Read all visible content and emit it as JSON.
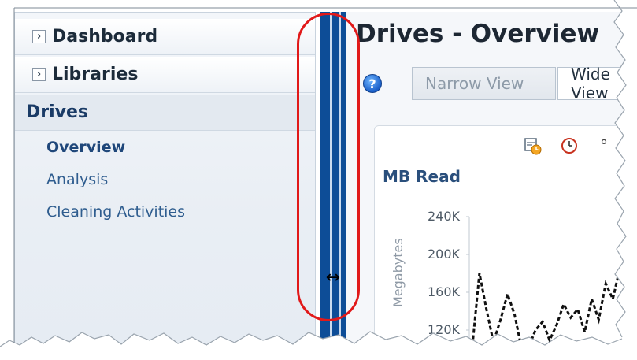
{
  "nav": {
    "dashboard": "Dashboard",
    "libraries": "Libraries",
    "drives": "Drives",
    "drive_items": [
      "Overview",
      "Analysis",
      "Cleaning Activities"
    ],
    "chevron": "chevron-right-icon"
  },
  "main": {
    "page_title": "Drives - Overview",
    "help_icon": "?",
    "narrow_view": "Narrow View",
    "wide_view": "Wide View"
  },
  "chart": {
    "toolbar_icons": [
      "calendar-clock-icon",
      "clock-icon",
      "more-icon"
    ],
    "title": "MB Read",
    "ylabel": "Megabytes"
  },
  "chart_data": {
    "type": "line",
    "title": "MB Read",
    "ylabel": "Megabytes",
    "yticks": [
      "240K",
      "200K",
      "160K",
      "120K"
    ],
    "ylim": [
      110000,
      240000
    ],
    "series": [
      {
        "style": "dashed",
        "color": "#111111",
        "values": [
          115000,
          185000,
          150000,
          118000,
          140000,
          165000,
          145000,
          112000,
          113000,
          130000,
          138000,
          120000,
          135000,
          155000,
          142000,
          150000,
          128000,
          160000,
          140000,
          175000,
          160000,
          190000,
          165000,
          135000
        ]
      }
    ]
  },
  "colors": {
    "splitter": "#0d4d97",
    "callout": "#e11919",
    "nav_text": "#2f5d8f"
  }
}
